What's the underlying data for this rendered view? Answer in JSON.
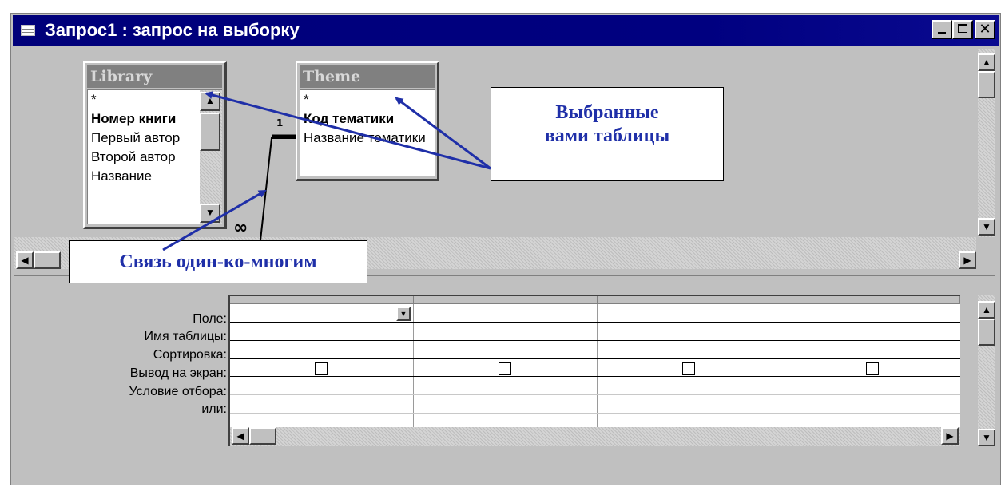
{
  "window": {
    "title": "Запрос1 : запрос на выборку"
  },
  "title_buttons": {
    "minimize": "",
    "maximize": "",
    "close": "✕"
  },
  "tables": [
    {
      "name": "Library",
      "fields": [
        "*",
        "Номер книги",
        "Первый автор",
        "Второй автор",
        "Название"
      ]
    },
    {
      "name": "Theme",
      "fields": [
        "*",
        "Код тематики",
        "Название тематики"
      ]
    }
  ],
  "relationship": {
    "one_label": "1",
    "many_label": "∞"
  },
  "callouts": {
    "tables": [
      "Выбранные",
      "вами таблицы"
    ],
    "link": "Связь один-ко-многим"
  },
  "accent_color": "#1f2fa8",
  "design_grid": {
    "row_labels": [
      "Поле:",
      "Имя таблицы:",
      "Сортировка:",
      "Вывод на экран:",
      "Условие отбора:",
      "или:"
    ],
    "column_count": 4,
    "show_checked": [
      false,
      false,
      false,
      false
    ]
  }
}
